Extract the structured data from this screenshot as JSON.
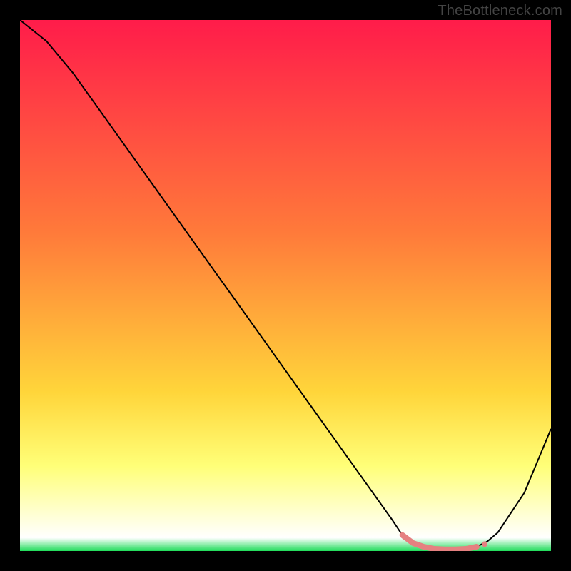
{
  "watermark": "TheBottleneck.com",
  "chart_data": {
    "type": "line",
    "title": "",
    "xlabel": "",
    "ylabel": "",
    "xlim": [
      0,
      100
    ],
    "ylim": [
      0,
      100
    ],
    "grid": false,
    "series": [
      {
        "name": "primary-curve",
        "color": "#000000",
        "x": [
          0,
          5,
          10,
          15,
          20,
          25,
          30,
          35,
          40,
          45,
          50,
          55,
          60,
          65,
          70,
          72,
          74,
          76,
          78,
          80,
          82,
          84,
          86,
          88,
          90,
          95,
          100
        ],
        "y": [
          100,
          96,
          90,
          83,
          76,
          69,
          62,
          55,
          48,
          41,
          34,
          27,
          20,
          13,
          6,
          3,
          1.5,
          0.8,
          0.4,
          0.3,
          0.3,
          0.4,
          0.8,
          1.8,
          3.5,
          11,
          23
        ]
      },
      {
        "name": "highlight-band",
        "color": "#e58080",
        "x": [
          72,
          74,
          76,
          78,
          80,
          82,
          84,
          86
        ],
        "y": [
          3,
          1.5,
          0.8,
          0.4,
          0.3,
          0.3,
          0.4,
          0.8
        ]
      }
    ],
    "markers": [
      {
        "name": "marker-a",
        "x": 86,
        "y": 0.8,
        "color": "#e58080",
        "size": 4
      },
      {
        "name": "marker-b",
        "x": 87.5,
        "y": 1.3,
        "color": "#e58080",
        "size": 4
      }
    ],
    "background_gradient": {
      "type": "vertical",
      "stops": [
        {
          "offset": 0.0,
          "color": "#ff1c4a"
        },
        {
          "offset": 0.4,
          "color": "#ff7a3a"
        },
        {
          "offset": 0.7,
          "color": "#ffd53a"
        },
        {
          "offset": 0.84,
          "color": "#ffff78"
        },
        {
          "offset": 0.92,
          "color": "#ffffc8"
        },
        {
          "offset": 0.975,
          "color": "#ffffff"
        },
        {
          "offset": 1.0,
          "color": "#1fdc5a"
        }
      ]
    }
  }
}
